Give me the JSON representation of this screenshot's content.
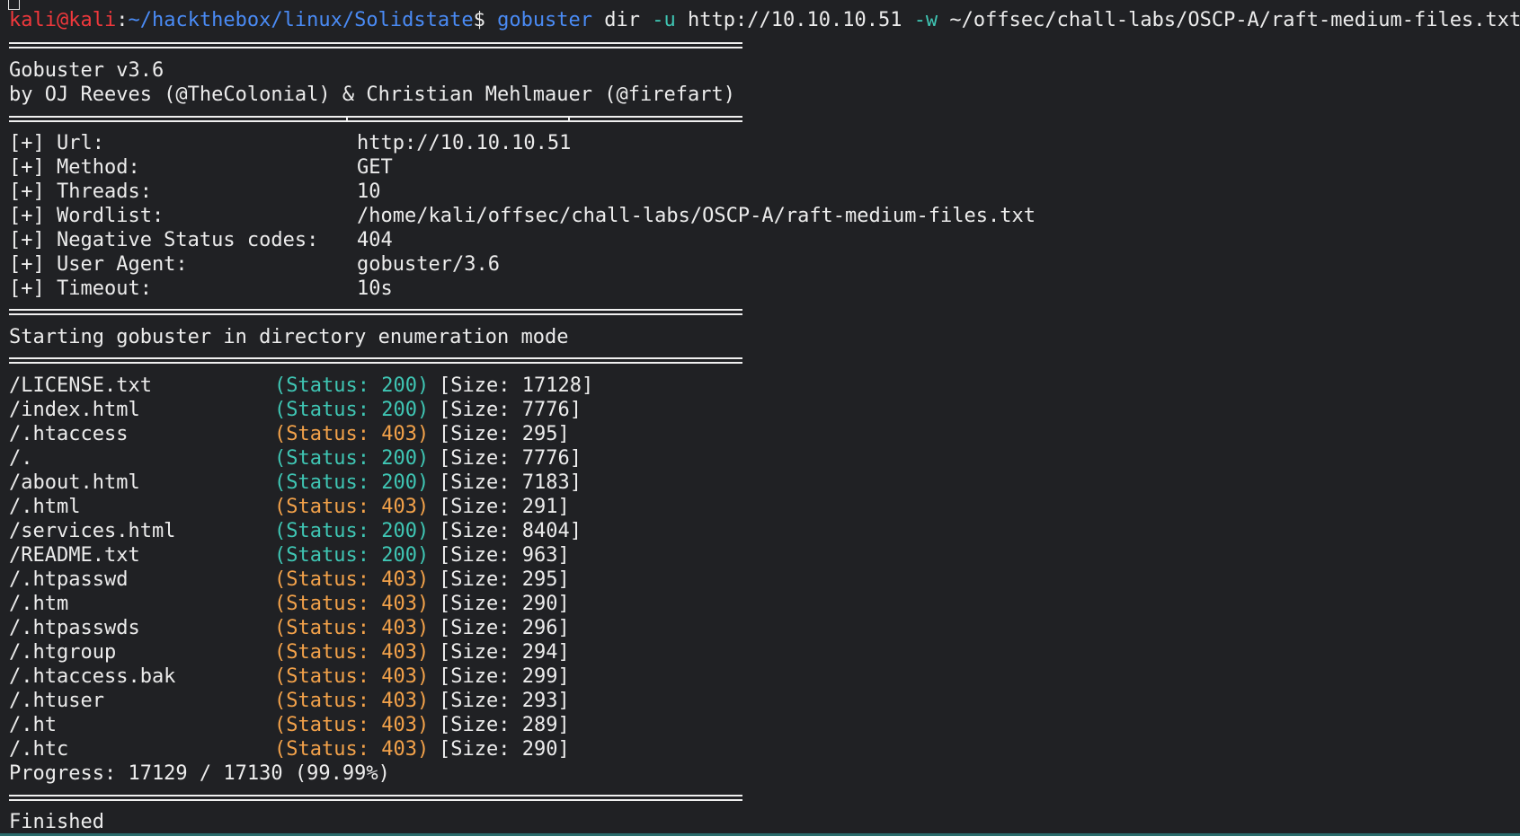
{
  "prompt": {
    "user": "kali",
    "at": "@",
    "host": "kali",
    "colon": ":",
    "path": "~/hackthebox/linux/Solidstate",
    "symbol": "$ ",
    "cmd": "gobuster",
    "args1": " dir ",
    "flag_u": "-u",
    "url": " http://10.10.10.51 ",
    "flag_w": "-w",
    "wordlist": " ~/offsec/chall-labs/OSCP-A/raft-medium-files.txt"
  },
  "banner": {
    "version": "Gobuster v3.6",
    "authors": "by OJ Reeves (@TheColonial) & Christian Mehlmauer (@firefart)"
  },
  "config": [
    {
      "key": "[+] Url:",
      "value": "http://10.10.10.51"
    },
    {
      "key": "[+] Method:",
      "value": "GET"
    },
    {
      "key": "[+] Threads:",
      "value": "10"
    },
    {
      "key": "[+] Wordlist:",
      "value": "/home/kali/offsec/chall-labs/OSCP-A/raft-medium-files.txt"
    },
    {
      "key": "[+] Negative Status codes:",
      "value": "404"
    },
    {
      "key": "[+] User Agent:",
      "value": "gobuster/3.6"
    },
    {
      "key": "[+] Timeout:",
      "value": "10s"
    }
  ],
  "start_msg": "Starting gobuster in directory enumeration mode",
  "results": [
    {
      "path": "/LICENSE.txt",
      "status": "(Status: 200)",
      "size": "[Size: 17128]",
      "code": "200"
    },
    {
      "path": "/index.html",
      "status": "(Status: 200)",
      "size": "[Size: 7776]",
      "code": "200"
    },
    {
      "path": "/.htaccess",
      "status": "(Status: 403)",
      "size": "[Size: 295]",
      "code": "403"
    },
    {
      "path": "/.",
      "status": "(Status: 200)",
      "size": "[Size: 7776]",
      "code": "200"
    },
    {
      "path": "/about.html",
      "status": "(Status: 200)",
      "size": "[Size: 7183]",
      "code": "200"
    },
    {
      "path": "/.html",
      "status": "(Status: 403)",
      "size": "[Size: 291]",
      "code": "403"
    },
    {
      "path": "/services.html",
      "status": "(Status: 200)",
      "size": "[Size: 8404]",
      "code": "200"
    },
    {
      "path": "/README.txt",
      "status": "(Status: 200)",
      "size": "[Size: 963]",
      "code": "200"
    },
    {
      "path": "/.htpasswd",
      "status": "(Status: 403)",
      "size": "[Size: 295]",
      "code": "403"
    },
    {
      "path": "/.htm",
      "status": "(Status: 403)",
      "size": "[Size: 290]",
      "code": "403"
    },
    {
      "path": "/.htpasswds",
      "status": "(Status: 403)",
      "size": "[Size: 296]",
      "code": "403"
    },
    {
      "path": "/.htgroup",
      "status": "(Status: 403)",
      "size": "[Size: 294]",
      "code": "403"
    },
    {
      "path": "/.htaccess.bak",
      "status": "(Status: 403)",
      "size": "[Size: 299]",
      "code": "403"
    },
    {
      "path": "/.htuser",
      "status": "(Status: 403)",
      "size": "[Size: 293]",
      "code": "403"
    },
    {
      "path": "/.ht",
      "status": "(Status: 403)",
      "size": "[Size: 289]",
      "code": "403"
    },
    {
      "path": "/.htc",
      "status": "(Status: 403)",
      "size": "[Size: 290]",
      "code": "403"
    }
  ],
  "progress": "Progress: 17129 / 17130 (99.99%)",
  "finished": "Finished",
  "colors": {
    "ok": "#3fc6b4",
    "forbidden": "#f3a24a",
    "user": "#f0383c",
    "path": "#4a8bf5"
  }
}
